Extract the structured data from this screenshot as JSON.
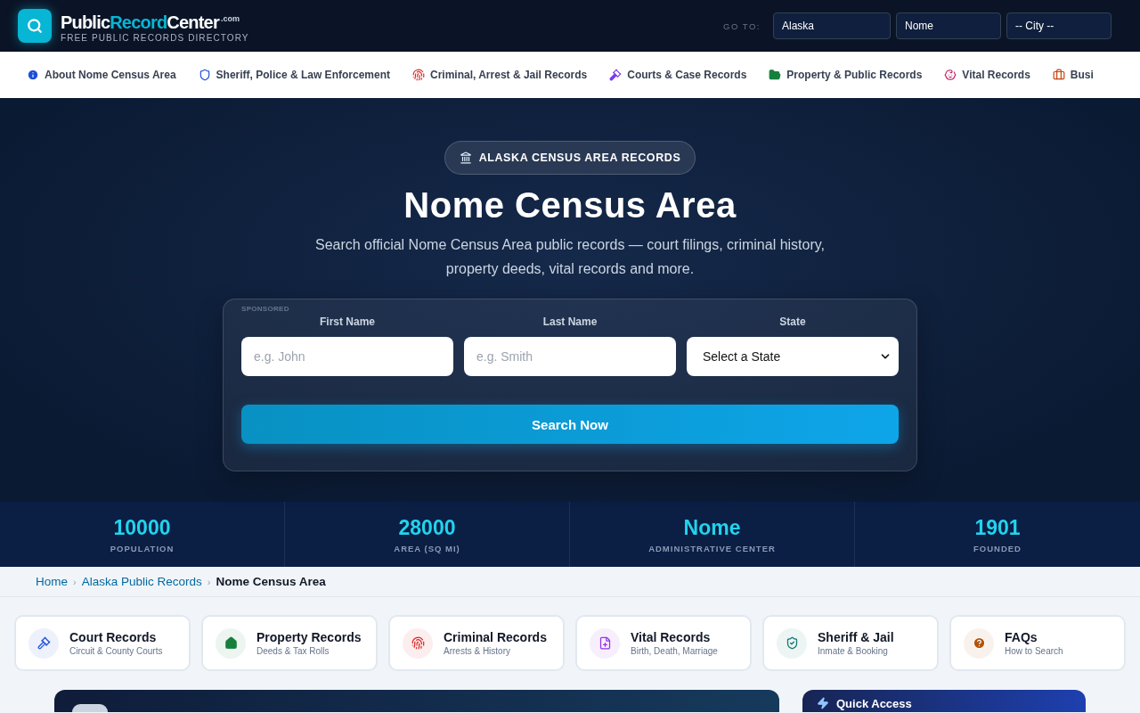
{
  "header": {
    "logo": {
      "part1": "Public",
      "part2": "Record",
      "part3": "Center",
      "suffix": ".com",
      "tagline": "FREE PUBLIC RECORDS DIRECTORY"
    },
    "goto_label": "GO TO:",
    "selects": [
      {
        "value": "Alaska"
      },
      {
        "value": "Nome"
      },
      {
        "value": "-- City --"
      }
    ]
  },
  "nav": [
    {
      "label": "About Nome Census Area",
      "kind": "info"
    },
    {
      "label": "Sheriff, Police & Law Enforcement",
      "kind": "shield"
    },
    {
      "label": "Criminal, Arrest & Jail Records",
      "kind": "fingerprint"
    },
    {
      "label": "Courts & Case Records",
      "kind": "gavel"
    },
    {
      "label": "Property & Public Records",
      "kind": "folder"
    },
    {
      "label": "Vital Records",
      "kind": "baby"
    },
    {
      "label": "Busi",
      "kind": "briefcase"
    }
  ],
  "hero": {
    "badge": "ALASKA CENSUS AREA RECORDS",
    "title": "Nome Census Area",
    "subtitle": "Search official Nome Census Area public records — court filings, criminal history, property deeds, vital records and more.",
    "search": {
      "sponsored": "SPONSORED",
      "fields": [
        {
          "label": "First Name",
          "placeholder": "e.g. John",
          "kind": "input"
        },
        {
          "label": "Last Name",
          "placeholder": "e.g. Smith",
          "kind": "input"
        },
        {
          "label": "State",
          "value": "Select a State",
          "kind": "select"
        }
      ],
      "button": "Search Now"
    }
  },
  "stats": [
    {
      "value": "10000",
      "label": "POPULATION"
    },
    {
      "value": "28000",
      "label": "AREA (SQ MI)"
    },
    {
      "value": "Nome",
      "label": "ADMINISTRATIVE CENTER"
    },
    {
      "value": "1901",
      "label": "FOUNDED"
    }
  ],
  "breadcrumb_separator": "›",
  "breadcrumb": [
    {
      "label": "Home",
      "current": false
    },
    {
      "label": "Alaska Public Records",
      "current": false
    },
    {
      "label": "Nome Census Area",
      "current": true
    }
  ],
  "quick_links": [
    {
      "title": "Court Records",
      "subtitle": "Circuit & County Courts",
      "kind": "gavel",
      "color": "#1d4ed8"
    },
    {
      "title": "Property Records",
      "subtitle": "Deeds & Tax Rolls",
      "kind": "home",
      "color": "#15803d"
    },
    {
      "title": "Criminal Records",
      "subtitle": "Arrests & History",
      "kind": "fingerprint",
      "color": "#dc2626"
    },
    {
      "title": "Vital Records",
      "subtitle": "Birth, Death, Marriage",
      "kind": "file",
      "color": "#9333ea"
    },
    {
      "title": "Sheriff & Jail",
      "subtitle": "Inmate & Booking",
      "kind": "shield",
      "color": "#0f766e"
    },
    {
      "title": "FAQs",
      "subtitle": "How to Search",
      "kind": "question",
      "color": "#b45309"
    }
  ],
  "sidebar": {
    "title": "Quick Access"
  }
}
